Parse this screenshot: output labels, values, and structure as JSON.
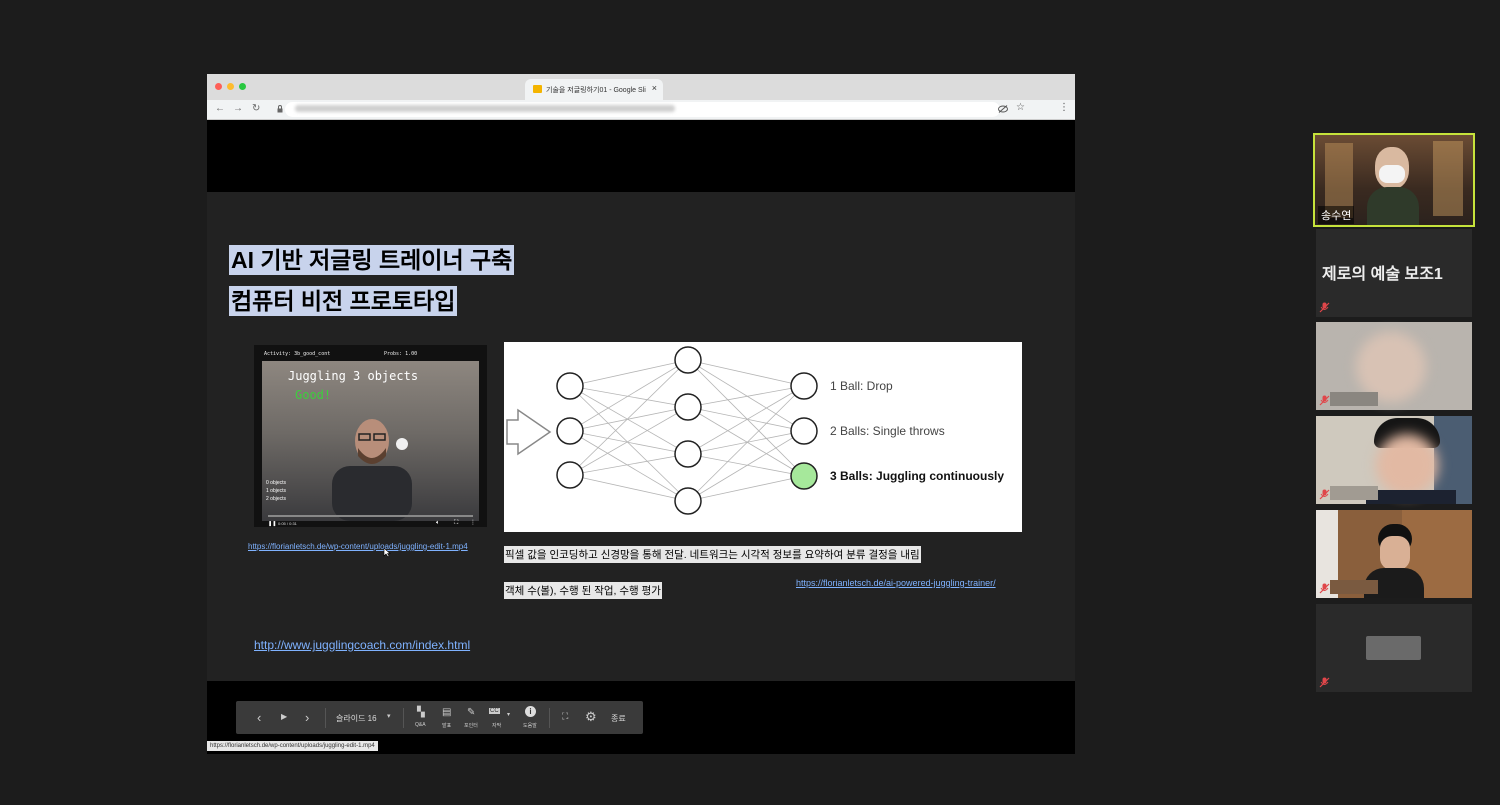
{
  "browser": {
    "tab_title": "기술을 저글링하기01 - Google Sli",
    "tab_close": "×",
    "nav_back": "←",
    "nav_forward": "→",
    "reload": "↻"
  },
  "slide": {
    "title_line1": "AI 기반 저글링 트레이너 구축",
    "title_line2": "컴퓨터 비전 프로토타입",
    "video": {
      "overlay_title": "Juggling 3 objects",
      "overlay_status": "Good!",
      "activity_label": "Activity: 3b_good_cont",
      "frame_label": "Probs: 1.00",
      "side_counts": [
        "0 objects",
        "1 objects",
        "2 objects"
      ],
      "time": "0:05 / 0:31",
      "link": "https://florianletsch.de/wp-content/uploads/juggling-edit-1.mp4"
    },
    "network": {
      "outputs": [
        "1 Ball: Drop",
        "2 Balls: Single throws",
        "3 Balls: Juggling continuously"
      ],
      "highlight_color": "#a6e89b"
    },
    "caption_main": "픽셀 값을 인코딩하고 신경망을 통해 전달. 네트워크는 시각적 정보를 요약하여 분류 결정을 내림",
    "caption_sub": "객체 수(볼), 수행 된 작업, 수행 평가",
    "network_link": "https://florianletsch.de/ai-powered-juggling-trainer/",
    "coach_link": "http://www.jugglingcoach.com/index.html"
  },
  "controls": {
    "prev": "‹",
    "play": "▶",
    "next": "›",
    "slide_label": "슬라이드 16",
    "qa_label": "Q&A",
    "notes_label": "발표",
    "pointer_label": "포인터",
    "captions_label": "자막",
    "help_label": "도움말",
    "end_label": "종료"
  },
  "status_url": "https://florianletsch.de/wp-content/uploads/juggling-edit-1.mp4",
  "participants": [
    {
      "name": "송수연",
      "active": true
    },
    {
      "name": "제로의 예술 보조1",
      "muted": true
    },
    {
      "muted": true
    },
    {
      "muted": true
    },
    {
      "muted": true
    },
    {
      "muted": true
    }
  ],
  "colors": {
    "active_border": "#c6e33b",
    "title_highlight": "#c8d3ec",
    "link": "#7fb2ff",
    "muted_icon": "#e0464a"
  }
}
